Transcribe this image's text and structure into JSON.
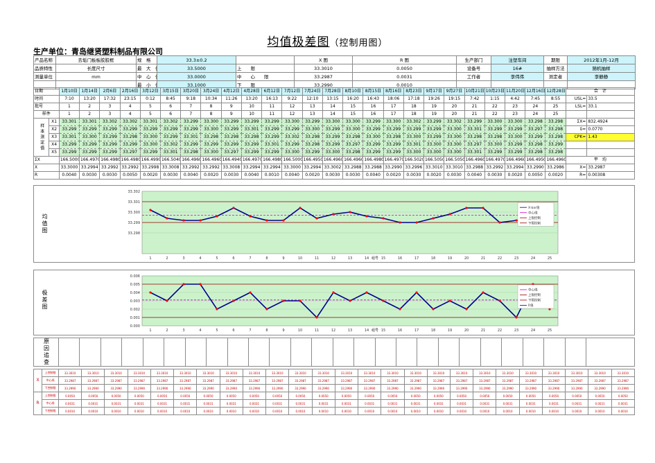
{
  "title": {
    "main": "均值极差图",
    "sub": "（控制用图）"
  },
  "company": "生产单位：青岛继贤塑料制品有限公司",
  "info": {
    "product_name_label": "产品名称",
    "product_name": "去垢门板板胶胶框",
    "char_label": "品质特性",
    "char_value": "长度尺寸",
    "unit_label": "测量单位",
    "unit_value": "mm",
    "spec_label": "规　格",
    "spec_value": "33.3±0.2",
    "max_label": "最　大　值",
    "max_value": "33.5000",
    "center_label": "中　心　值",
    "center_value": "33.0000",
    "min_label": "最　小　值",
    "min_value": "33.1000",
    "xbar_header": "X 图",
    "r_header": "R 图",
    "ucl_label": "上　　限",
    "cl_label": "中　　心　　限",
    "lcl_label": "下　　限",
    "x_ucl": "33.3010",
    "x_cl": "33.2987",
    "x_lcl": "33.2990",
    "r_ucl": "0.0050",
    "r_cl": "0.0031",
    "r_lcl": "0.0010",
    "dept_label": "生产部门",
    "dept_value": "注塑车间",
    "period_label": "期限",
    "period_value": "2012年1月-12月",
    "machine_label": "设备号",
    "machine_value": "16#",
    "sampling_label": "抽样方法",
    "sampling_value": "随机抽样",
    "operator_label": "工作者",
    "operator_value": "李伟伟",
    "inspector_label": "测定者",
    "inspector_value": "李静静"
  },
  "table": {
    "date_label": "日期",
    "time_label": "时间",
    "lot_label": "批号",
    "group_label": "样件",
    "dates": [
      "1月10日",
      "1月14日",
      "2月6日",
      "2月16日",
      "3月12日",
      "3月15日",
      "3月20日",
      "3月24日",
      "4月12日",
      "4月28日",
      "6月12日",
      "7月12日",
      "7月24日",
      "7月28日",
      "8月10日",
      "8月15日",
      "8月16日",
      "8月23日",
      "9月17日",
      "9月27日",
      "10月21日",
      "10月23日",
      "11月20日",
      "12月16日",
      "12月28日"
    ],
    "times": [
      "7:10",
      "13:20",
      "17:32",
      "23:15",
      "0:12",
      "8:45",
      "9:18",
      "10:34",
      "11:26",
      "13:20",
      "16:13",
      "9:22",
      "12:10",
      "13:15",
      "16:20",
      "16:43",
      "18:06",
      "17:18",
      "19:26",
      "19:15",
      "7:42",
      "1:15",
      "4:42",
      "7:45",
      "8:55"
    ],
    "groups": [
      "1",
      "2",
      "3",
      "4",
      "5",
      "6",
      "7",
      "8",
      "9",
      "10",
      "11",
      "12",
      "13",
      "14",
      "15",
      "16",
      "17",
      "18",
      "19",
      "20",
      "21",
      "22",
      "23",
      "24",
      "25"
    ],
    "row_labels": [
      "X1",
      "X2",
      "X3",
      "X4",
      "X5"
    ],
    "sample_label": "样本测定值",
    "rows": [
      [
        "33.301",
        "33.301",
        "33.302",
        "33.302",
        "33.301",
        "33.302",
        "33.299",
        "33.300",
        "33.299",
        "33.299",
        "33.299",
        "33.300",
        "33.299",
        "33.300",
        "33.300",
        "33.299",
        "33.300",
        "33.302",
        "33.299",
        "33.302",
        "33.299",
        "33.300",
        "33.300",
        "33.298",
        "33.298"
      ],
      [
        "33.299",
        "33.299",
        "33.299",
        "33.299",
        "33.299",
        "33.299",
        "33.299",
        "33.300",
        "33.299",
        "33.301",
        "33.299",
        "33.299",
        "33.300",
        "33.299",
        "33.300",
        "33.299",
        "33.299",
        "33.299",
        "33.299",
        "33.300",
        "33.301",
        "33.299",
        "33.299",
        "33.297",
        "33.298"
      ],
      [
        "33.301",
        "33.300",
        "33.299",
        "33.298",
        "33.300",
        "33.299",
        "33.301",
        "33.298",
        "33.298",
        "33.298",
        "33.299",
        "33.302",
        "33.298",
        "33.299",
        "33.298",
        "33.300",
        "33.298",
        "33.300",
        "33.299",
        "33.300",
        "33.298",
        "33.298",
        "33.300",
        "33.299",
        "33.298"
      ],
      [
        "33.299",
        "33.299",
        "33.299",
        "33.299",
        "33.300",
        "33.302",
        "33.299",
        "33.299",
        "33.299",
        "33.299",
        "33.301",
        "33.299",
        "33.298",
        "33.299",
        "33.297",
        "33.299",
        "33.299",
        "33.301",
        "33.300",
        "33.300",
        "33.297",
        "33.300",
        "33.299",
        "33.298",
        "33.299"
      ],
      [
        "33.299",
        "33.299",
        "33.299",
        "33.297",
        "33.299",
        "33.301",
        "33.298",
        "33.300",
        "33.297",
        "33.299",
        "33.299",
        "33.300",
        "33.299",
        "33.300",
        "33.298",
        "33.299",
        "33.299",
        "33.300",
        "33.300",
        "33.300",
        "33.301",
        "33.299",
        "33.299",
        "33.298",
        "33.298"
      ]
    ],
    "sum_label": "ΣX",
    "mean_label": "X",
    "range_label": "R",
    "sums": [
      "166.5000",
      "166.4970",
      "166.4980",
      "166.4980",
      "166.4990",
      "166.5040",
      "166.4960",
      "166.4960",
      "166.4940",
      "166.4970",
      "166.4980",
      "166.5000",
      "166.4950",
      "166.4960",
      "166.4960",
      "166.4980",
      "166.4970",
      "166.5020",
      "166.5050",
      "166.5050",
      "166.4960",
      "166.4970",
      "166.4960",
      "166.4950",
      "166.4960"
    ],
    "means": [
      "33.3000",
      "33.2994",
      "33.2992",
      "33.2992",
      "33.2998",
      "33.3008",
      "33.2992",
      "33.2992",
      "33.3008",
      "33.2994",
      "33.2994",
      "33.3000",
      "33.2994",
      "33.3002",
      "33.2988",
      "33.2988",
      "33.2990",
      "33.2996",
      "33.3010",
      "33.3010",
      "33.2988",
      "33.2992",
      "33.2994",
      "33.2990",
      "33.2986"
    ],
    "ranges": [
      "0.0040",
      "0.0030",
      "0.0030",
      "0.0050",
      "0.0020",
      "0.0030",
      "0.0040",
      "0.0020",
      "0.0030",
      "0.0040",
      "0.0010",
      "0.0040",
      "0.0020",
      "0.0030",
      "0.0030",
      "0.0040",
      "0.0020",
      "0.0030",
      "0.0020",
      "0.0030",
      "0.0040",
      "0.0030",
      "0.0020",
      "0.0050",
      "0.0020"
    ],
    "total_label": "合　计",
    "usl_label": "USL=",
    "usl_value": "33.5",
    "lsl_label": "LSL=",
    "lsl_value": "33.1",
    "sumx_label": "ΣX=",
    "sumx_value": "832.4924",
    "sigma_label": "δ=",
    "sigma_value": "0.0770",
    "cpk_label": "CPK=",
    "cpk_value": "1.43",
    "avg_label": "平　均",
    "xbarbar_label": "X=",
    "xbarbar_value": "33.2987",
    "rbar_label": "R=",
    "rbar_value": "0.00308"
  },
  "charts": {
    "xbar_label": "均值图",
    "r_label": "极差图",
    "reason_label": "原因追查",
    "xbar_legend": [
      "X-bar值",
      "中心线",
      "上限控制",
      "下限控制"
    ],
    "r_legend": [
      "中心线",
      "上限控制",
      "下限控制",
      "R值"
    ],
    "x_axis_note": "组号"
  },
  "chart_data": [
    {
      "type": "line",
      "xlabel": "组号",
      "x": [
        1,
        2,
        3,
        4,
        5,
        6,
        7,
        8,
        9,
        10,
        11,
        12,
        13,
        14,
        15,
        16,
        17,
        18,
        19,
        20,
        21,
        22,
        23,
        24,
        25
      ],
      "series": [
        {
          "name": "X-bar值",
          "values": [
            33.3002,
            33.2994,
            33.2992,
            33.2992,
            33.2996,
            33.3004,
            33.2996,
            33.2992,
            33.2992,
            33.3004,
            33.2994,
            33.2998,
            33.3,
            33.2996,
            33.2994,
            33.299,
            33.299,
            33.2994,
            33.2998,
            33.3004,
            33.3004,
            33.299,
            33.2992,
            33.2994,
            33.299
          ]
        },
        {
          "name": "中心线",
          "values": [
            33.2997
          ]
        },
        {
          "name": "上限控制",
          "values": [
            33.301
          ]
        },
        {
          "name": "下限控制",
          "values": [
            33.299
          ]
        }
      ],
      "ylim": [
        33.296,
        33.302
      ],
      "yticks": [
        "33.302",
        "33.301",
        "33.300",
        "33.299",
        "33.298"
      ]
    },
    {
      "type": "line",
      "xlabel": "组号",
      "x": [
        1,
        2,
        3,
        4,
        5,
        6,
        7,
        8,
        9,
        10,
        11,
        12,
        13,
        14,
        15,
        16,
        17,
        18,
        19,
        20,
        21,
        22,
        23,
        24,
        25
      ],
      "series": [
        {
          "name": "R值",
          "values": [
            0.004,
            0.003,
            0.005,
            0.005,
            0.002,
            0.003,
            0.004,
            0.002,
            0.003,
            0.003,
            0.001,
            0.004,
            0.003,
            0.004,
            0.003,
            0.002,
            0.004,
            0.002,
            0.003,
            0.002,
            0.004,
            0.003,
            0.001,
            0.005,
            0.002
          ]
        },
        {
          "name": "中心线",
          "values": [
            0.0031
          ]
        },
        {
          "name": "上限控制",
          "values": [
            0.005
          ]
        },
        {
          "name": "下限控制",
          "values": [
            0.001
          ]
        }
      ],
      "ylim": [
        0,
        0.006
      ],
      "yticks": [
        "0.006",
        "0.005",
        "0.004",
        "0.003",
        "0.002",
        "0.001",
        "0.000"
      ]
    }
  ],
  "bottom": {
    "x_label": "X",
    "r_label": "R",
    "row_names": [
      "上控制限",
      "中心线",
      "下控制限",
      "上控制限",
      "中心线",
      "下控制限"
    ],
    "x_ucl": "33.3010",
    "x_cl": "33.2987",
    "x_lcl": "33.2990",
    "r_ucl": "0.0050",
    "r_cl": "0.0031",
    "r_lcl": "0.0010"
  },
  "colors": {
    "cyan": "#ccf4fa",
    "green_cells": "#ccf2cc",
    "chart_bg": "#ccf2cc",
    "series": "#00008b",
    "marker": "#ff0000",
    "cl": "#cc00cc",
    "limit": "#990000",
    "cpk": "#ffff33"
  }
}
